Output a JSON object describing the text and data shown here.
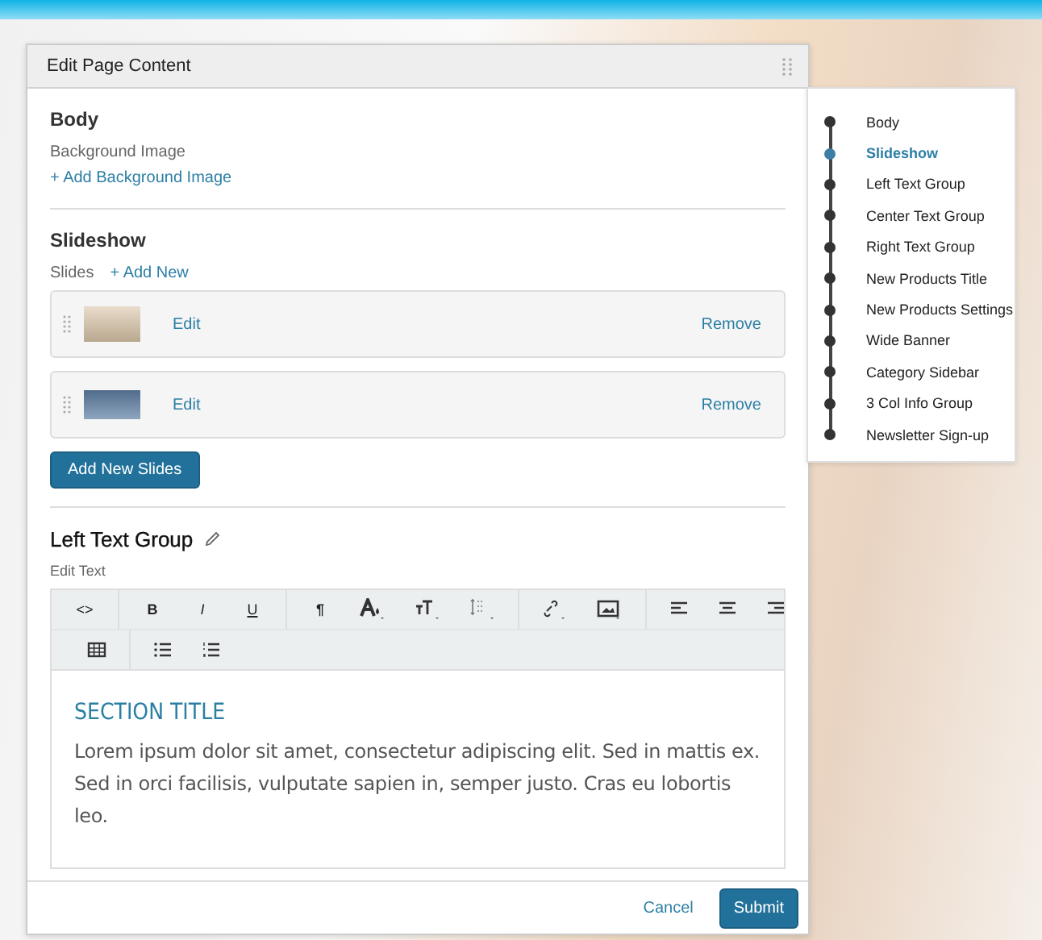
{
  "dialog": {
    "title": "Edit Page Content"
  },
  "body_section": {
    "title": "Body",
    "label": "Background Image",
    "add_link": "+ Add Background Image"
  },
  "slideshow": {
    "title": "Slideshow",
    "label": "Slides",
    "add_link": "+ Add New",
    "slides": [
      {
        "edit": "Edit",
        "remove": "Remove"
      },
      {
        "edit": "Edit",
        "remove": "Remove"
      }
    ],
    "add_button": "Add New Slides"
  },
  "text_group": {
    "title": "Left Text Group",
    "label": "Edit Text",
    "toolbar_labels": [
      "<>",
      "B",
      "I",
      "U",
      "¶"
    ],
    "heading": "SECTION TITLE",
    "paragraph": "Lorem ipsum dolor sit amet, consectetur adipiscing elit. Sed in mattis ex. Sed in orci facilisis, vulputate sapien in, semper justo. Cras eu lobortis leo."
  },
  "footer": {
    "cancel": "Cancel",
    "submit": "Submit"
  },
  "outline": [
    {
      "label": "Body",
      "selected": false
    },
    {
      "label": "Slideshow",
      "selected": true
    },
    {
      "label": "Left Text Group",
      "selected": false
    },
    {
      "label": "Center Text Group",
      "selected": false
    },
    {
      "label": "Right Text Group",
      "selected": false
    },
    {
      "label": "New Products Title",
      "selected": false
    },
    {
      "label": "New Products Settings",
      "selected": false
    },
    {
      "label": "Wide Banner",
      "selected": false
    },
    {
      "label": "Category Sidebar",
      "selected": false
    },
    {
      "label": "3 Col Info Group",
      "selected": false
    },
    {
      "label": "Newsletter Sign-up",
      "selected": false
    }
  ]
}
